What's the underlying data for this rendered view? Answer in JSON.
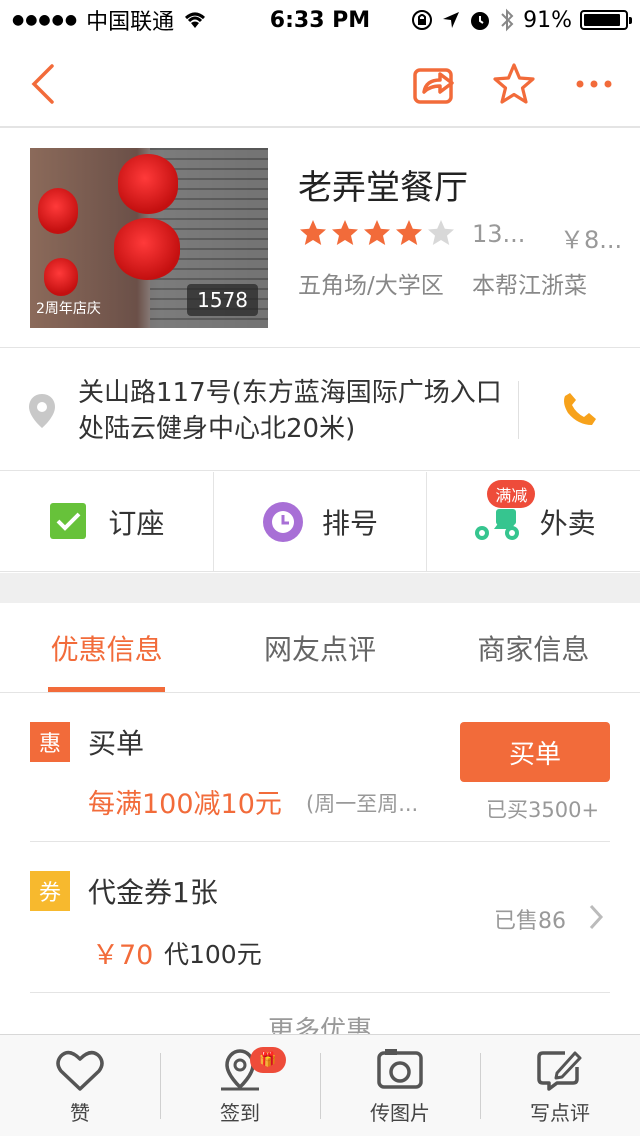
{
  "status_bar": {
    "carrier": "中国联通",
    "time": "6:33 PM",
    "battery": "91%",
    "battery_level": 0.91
  },
  "nav": {
    "back_icon": "chevron-left-icon",
    "share_icon": "share-icon",
    "favorite_icon": "star-outline-icon",
    "more_icon": "more-dots-icon",
    "accent_color": "#f26b3a"
  },
  "restaurant": {
    "name": "老弄堂餐厅",
    "photo_count": "1578",
    "photo_caption": "2周年店庆",
    "rating_stars": 4,
    "review_count": "13...",
    "price": "￥8...",
    "district": "五角场/大学区",
    "cuisine": "本帮江浙菜"
  },
  "address": {
    "text": "关山路117号(东方蓝海国际广场入口处陆云健身中心北20米)"
  },
  "actions": [
    {
      "label": "订座",
      "icon": "reserve-check-icon",
      "color": "#67c23a"
    },
    {
      "label": "排号",
      "icon": "queue-clock-icon",
      "color": "#a86fd6"
    },
    {
      "label": "外卖",
      "icon": "delivery-scooter-icon",
      "color": "#36c58f",
      "badge": "满减"
    }
  ],
  "tabs": [
    {
      "label": "优惠信息",
      "active": true
    },
    {
      "label": "网友点评",
      "active": false
    },
    {
      "label": "商家信息",
      "active": false
    }
  ],
  "deals": {
    "maidan": {
      "tag": "惠",
      "tag_color": "#f26b3a",
      "title": "买单",
      "offer": "每满100减10元",
      "note": "(周一至周...",
      "button": "买单",
      "bought": "已买3500+"
    },
    "voucher": {
      "tag": "券",
      "tag_color": "#f7b92e",
      "title": "代金券1张",
      "price": "￥70",
      "original": "代100元",
      "sold": "已售86"
    },
    "more": "更多优惠"
  },
  "bottom_bar": [
    {
      "label": "赞",
      "icon": "heart-icon"
    },
    {
      "label": "签到",
      "icon": "checkin-pin-icon",
      "badge_icon": "gift-icon"
    },
    {
      "label": "传图片",
      "icon": "camera-upload-icon"
    },
    {
      "label": "写点评",
      "icon": "write-review-icon"
    }
  ]
}
